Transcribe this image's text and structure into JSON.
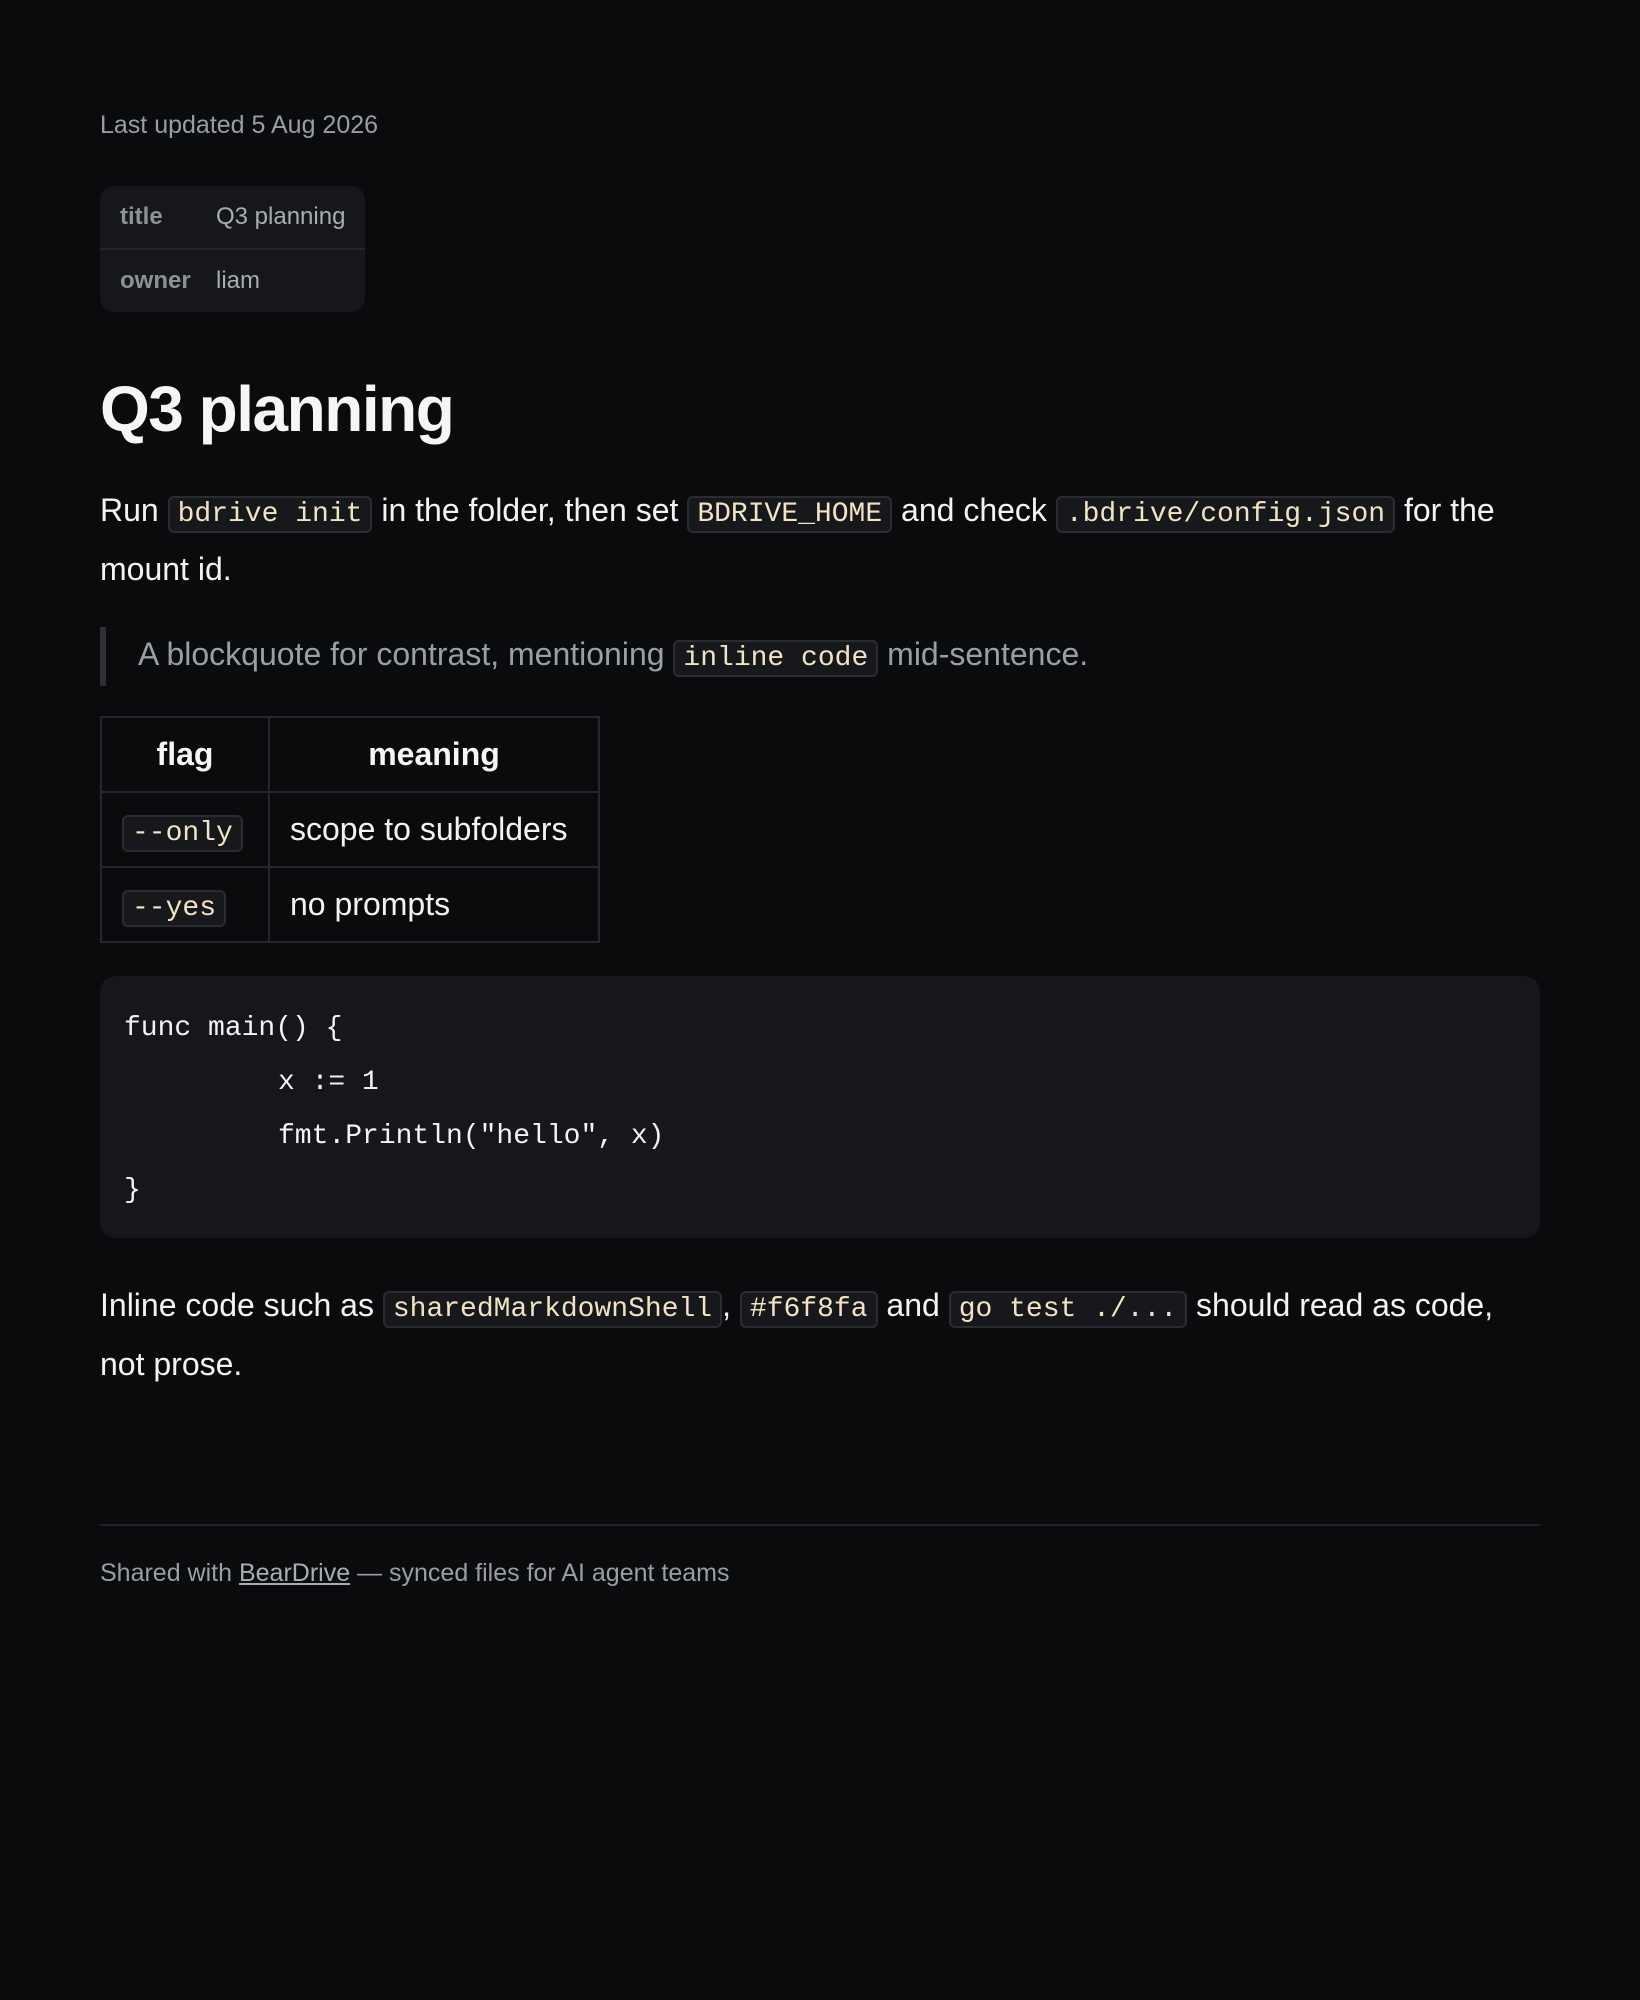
{
  "meta": {
    "last_updated": "Last updated 5 Aug 2026"
  },
  "frontmatter": {
    "rows": [
      {
        "key": "title",
        "value": "Q3 planning"
      },
      {
        "key": "owner",
        "value": "liam"
      }
    ]
  },
  "heading": "Q3 planning",
  "intro": {
    "t1": "Run ",
    "c1": "bdrive init",
    "t2": " in the folder, then set ",
    "c2": "BDRIVE_HOME",
    "t3": " and check ",
    "c3": ".bdrive/config.json",
    "t4": " for the mount id."
  },
  "blockquote": {
    "t1": "A blockquote for contrast, mentioning ",
    "c1": "inline code",
    "t2": " mid-sentence."
  },
  "table": {
    "headers": [
      "flag",
      "meaning"
    ],
    "rows": [
      {
        "flag": "--only",
        "meaning": "scope to subfolders"
      },
      {
        "flag": "--yes",
        "meaning": "no prompts"
      }
    ]
  },
  "code_block": {
    "lines": [
      "func main() {",
      "x := 1",
      "fmt.Println(\"hello\", x)",
      "}"
    ]
  },
  "closing": {
    "t1": "Inline code such as ",
    "c1": "sharedMarkdownShell",
    "t2": ", ",
    "c2": "#f6f8fa",
    "t3": " and ",
    "c3": "go test ./...",
    "t4": " should read as code, not prose."
  },
  "footer": {
    "prefix": "Shared with ",
    "link_text": "BearDrive",
    "suffix": " — synced files for AI agent teams"
  },
  "colors": {
    "background": "#0a0b0d",
    "text": "#f2f3f5",
    "muted": "#9a9da4",
    "code_text": "#f1e3c4",
    "code_bg": "#17181c"
  }
}
